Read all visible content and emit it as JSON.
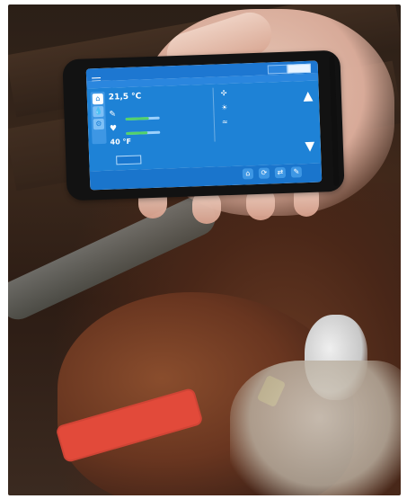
{
  "scene": {
    "description": "",
    "collar_text": ""
  },
  "app": {
    "title": "",
    "top_button": "",
    "sub_label": "",
    "temperature": "21,5 °C",
    "temp_2": "",
    "row2_value": "",
    "row3_value": "",
    "row4_value": "40 °F",
    "button_label": "",
    "bottom_text_1": "",
    "bottom_text_2": "",
    "icons": {
      "menu": "menu-icon",
      "up": "up-arrow-icon",
      "down": "down-arrow-icon",
      "pen": "pen-icon",
      "heart": "heart-icon",
      "drop": "drop-icon",
      "settings": "settings-icon",
      "home": "home-icon"
    },
    "bar_levels": {
      "row2": 0.68,
      "row3": 0.62
    },
    "colors": {
      "primary": "#1e82d6",
      "accent": "#54d26a"
    }
  }
}
